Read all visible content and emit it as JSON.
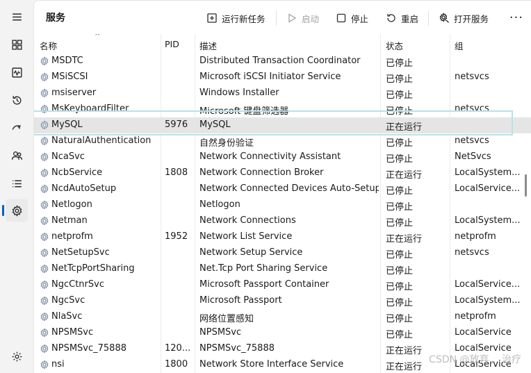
{
  "app": {
    "page_title": "服务",
    "accent_color": "#005fb8"
  },
  "nav": [
    {
      "name": "menu-icon"
    },
    {
      "name": "processes-icon"
    },
    {
      "name": "performance-icon"
    },
    {
      "name": "app-history-icon"
    },
    {
      "name": "startup-apps-icon"
    },
    {
      "name": "users-icon"
    },
    {
      "name": "details-icon"
    },
    {
      "name": "services-icon"
    },
    {
      "name": "settings-icon"
    }
  ],
  "toolbar": {
    "run_new_task": "运行新任务",
    "start": "启动",
    "stop": "停止",
    "restart": "重启",
    "open_services": "打开服务",
    "more": "···"
  },
  "table": {
    "headers": {
      "name": "名称",
      "pid": "PID",
      "description": "描述",
      "status": "状态",
      "group": "组"
    },
    "rows": [
      {
        "name": "MSDTC",
        "pid": "",
        "description": "Distributed Transaction Coordinator",
        "status": "已停止",
        "group": ""
      },
      {
        "name": "MSiSCSI",
        "pid": "",
        "description": "Microsoft iSCSI Initiator Service",
        "status": "已停止",
        "group": "netsvcs"
      },
      {
        "name": "msiserver",
        "pid": "",
        "description": "Windows Installer",
        "status": "已停止",
        "group": ""
      },
      {
        "name": "MsKeyboardFilter",
        "pid": "",
        "description": "Microsoft 键盘筛选器",
        "status": "已停止",
        "group": "netsvcs"
      },
      {
        "name": "MySQL",
        "pid": "5976",
        "description": "MySQL",
        "status": "正在运行",
        "group": ""
      },
      {
        "name": "NaturalAuthentication",
        "pid": "",
        "description": "自然身份验证",
        "status": "已停止",
        "group": "netsvcs"
      },
      {
        "name": "NcaSvc",
        "pid": "",
        "description": "Network Connectivity Assistant",
        "status": "已停止",
        "group": "NetSvcs"
      },
      {
        "name": "NcbService",
        "pid": "1808",
        "description": "Network Connection Broker",
        "status": "正在运行",
        "group": "LocalSystem..."
      },
      {
        "name": "NcdAutoSetup",
        "pid": "",
        "description": "Network Connected Devices Auto-Setup",
        "status": "已停止",
        "group": "LocalService..."
      },
      {
        "name": "Netlogon",
        "pid": "",
        "description": "Netlogon",
        "status": "已停止",
        "group": ""
      },
      {
        "name": "Netman",
        "pid": "",
        "description": "Network Connections",
        "status": "已停止",
        "group": "LocalSystem..."
      },
      {
        "name": "netprofm",
        "pid": "1952",
        "description": "Network List Service",
        "status": "正在运行",
        "group": "netprofm"
      },
      {
        "name": "NetSetupSvc",
        "pid": "",
        "description": "Network Setup Service",
        "status": "已停止",
        "group": "netsvcs"
      },
      {
        "name": "NetTcpPortSharing",
        "pid": "",
        "description": "Net.Tcp Port Sharing Service",
        "status": "已停止",
        "group": ""
      },
      {
        "name": "NgcCtnrSvc",
        "pid": "",
        "description": "Microsoft Passport Container",
        "status": "已停止",
        "group": "LocalService..."
      },
      {
        "name": "NgcSvc",
        "pid": "",
        "description": "Microsoft Passport",
        "status": "已停止",
        "group": "LocalSystem..."
      },
      {
        "name": "NlaSvc",
        "pid": "",
        "description": "网络位置感知",
        "status": "已停止",
        "group": "netprofm"
      },
      {
        "name": "NPSMSvc",
        "pid": "",
        "description": "NPSMSvc",
        "status": "已停止",
        "group": "LocalService"
      },
      {
        "name": "NPSMSvc_75888",
        "pid": "120...",
        "description": "NPSMSvc_75888",
        "status": "正在运行",
        "group": "LocalService"
      },
      {
        "name": "nsi",
        "pid": "1800",
        "description": "Network Store Interface Service",
        "status": "正在运行",
        "group": "LocalService"
      }
    ],
    "selected_index": 4
  },
  "watermark": "CSDN @放弃、 治疗"
}
